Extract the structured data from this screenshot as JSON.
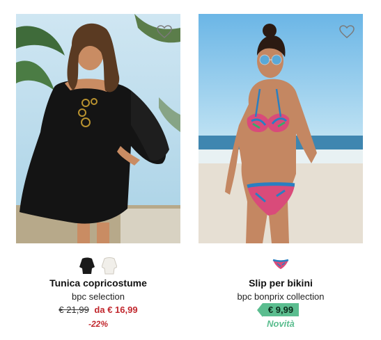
{
  "products": [
    {
      "name": "Tunica copricostume",
      "brand": "bpc selection",
      "old_price": "€ 21,99",
      "new_price": "da € 16,99",
      "discount": "-22%",
      "wishlist_icon": "heart-outline-icon",
      "swatches": [
        "black",
        "white"
      ]
    },
    {
      "name": "Slip per bikini",
      "brand": "bpc bonprix collection",
      "price": "€ 9,99",
      "badge": "Novità",
      "wishlist_icon": "heart-outline-icon",
      "swatches": [
        "pink-tropical"
      ]
    }
  ],
  "colors": {
    "sale_red": "#c1272d",
    "new_green": "#5bbd8f"
  }
}
